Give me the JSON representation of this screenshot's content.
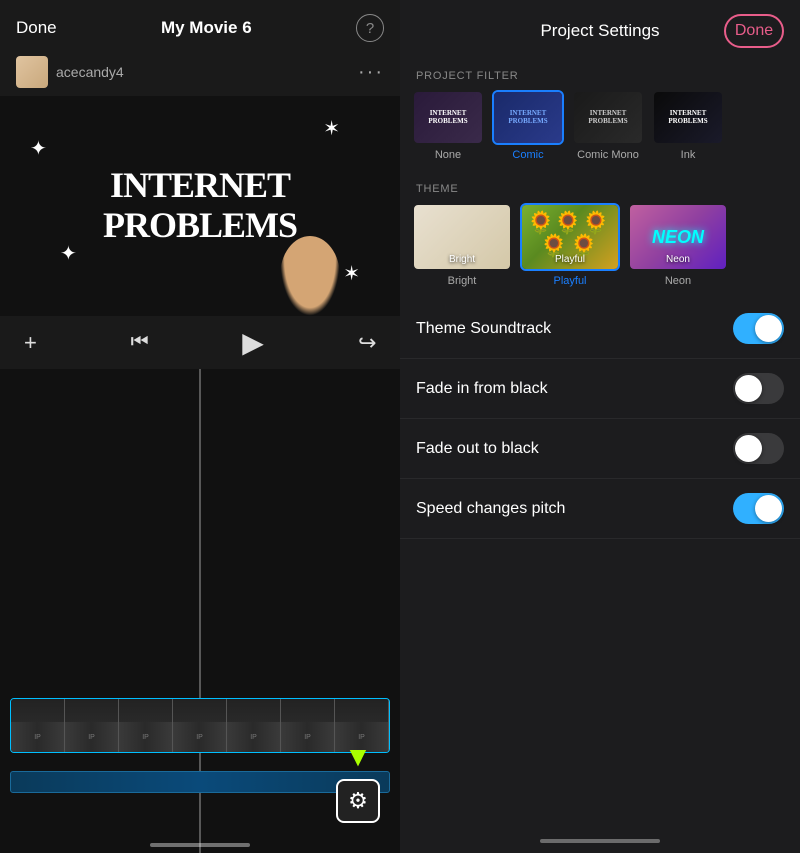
{
  "left": {
    "header": {
      "done_label": "Done",
      "title": "My Movie 6",
      "help_icon": "?"
    },
    "user": {
      "name": "acecandy4",
      "dots": "···"
    },
    "video": {
      "text_line1": "INTERNET",
      "text_line2": "PROBLEMS"
    },
    "controls": {
      "rewind_icon": "⏮",
      "play_icon": "▶",
      "undo_icon": "↩",
      "add_icon": "+"
    },
    "settings_arrow": "▼",
    "gear_icon": "⚙"
  },
  "right": {
    "header": {
      "title": "Project Settings",
      "done_label": "Done"
    },
    "project_filter": {
      "section_label": "PROJECT FILTER",
      "filters": [
        {
          "id": "none",
          "label": "None",
          "selected": false
        },
        {
          "id": "comic",
          "label": "Comic",
          "selected": true
        },
        {
          "id": "comic-mono",
          "label": "Comic Mono",
          "selected": false
        },
        {
          "id": "ink",
          "label": "Ink",
          "selected": false
        }
      ]
    },
    "theme": {
      "section_label": "THEME",
      "themes": [
        {
          "id": "bright",
          "label": "Bright",
          "selected": false
        },
        {
          "id": "playful",
          "label": "Playful",
          "selected": true
        },
        {
          "id": "neon",
          "label": "Neon",
          "selected": false
        }
      ]
    },
    "toggles": [
      {
        "id": "theme-soundtrack",
        "label": "Theme Soundtrack",
        "on": true
      },
      {
        "id": "fade-in",
        "label": "Fade in from black",
        "on": false
      },
      {
        "id": "fade-out",
        "label": "Fade out to black",
        "on": false
      },
      {
        "id": "speed-pitch",
        "label": "Speed changes pitch",
        "on": true
      }
    ]
  }
}
